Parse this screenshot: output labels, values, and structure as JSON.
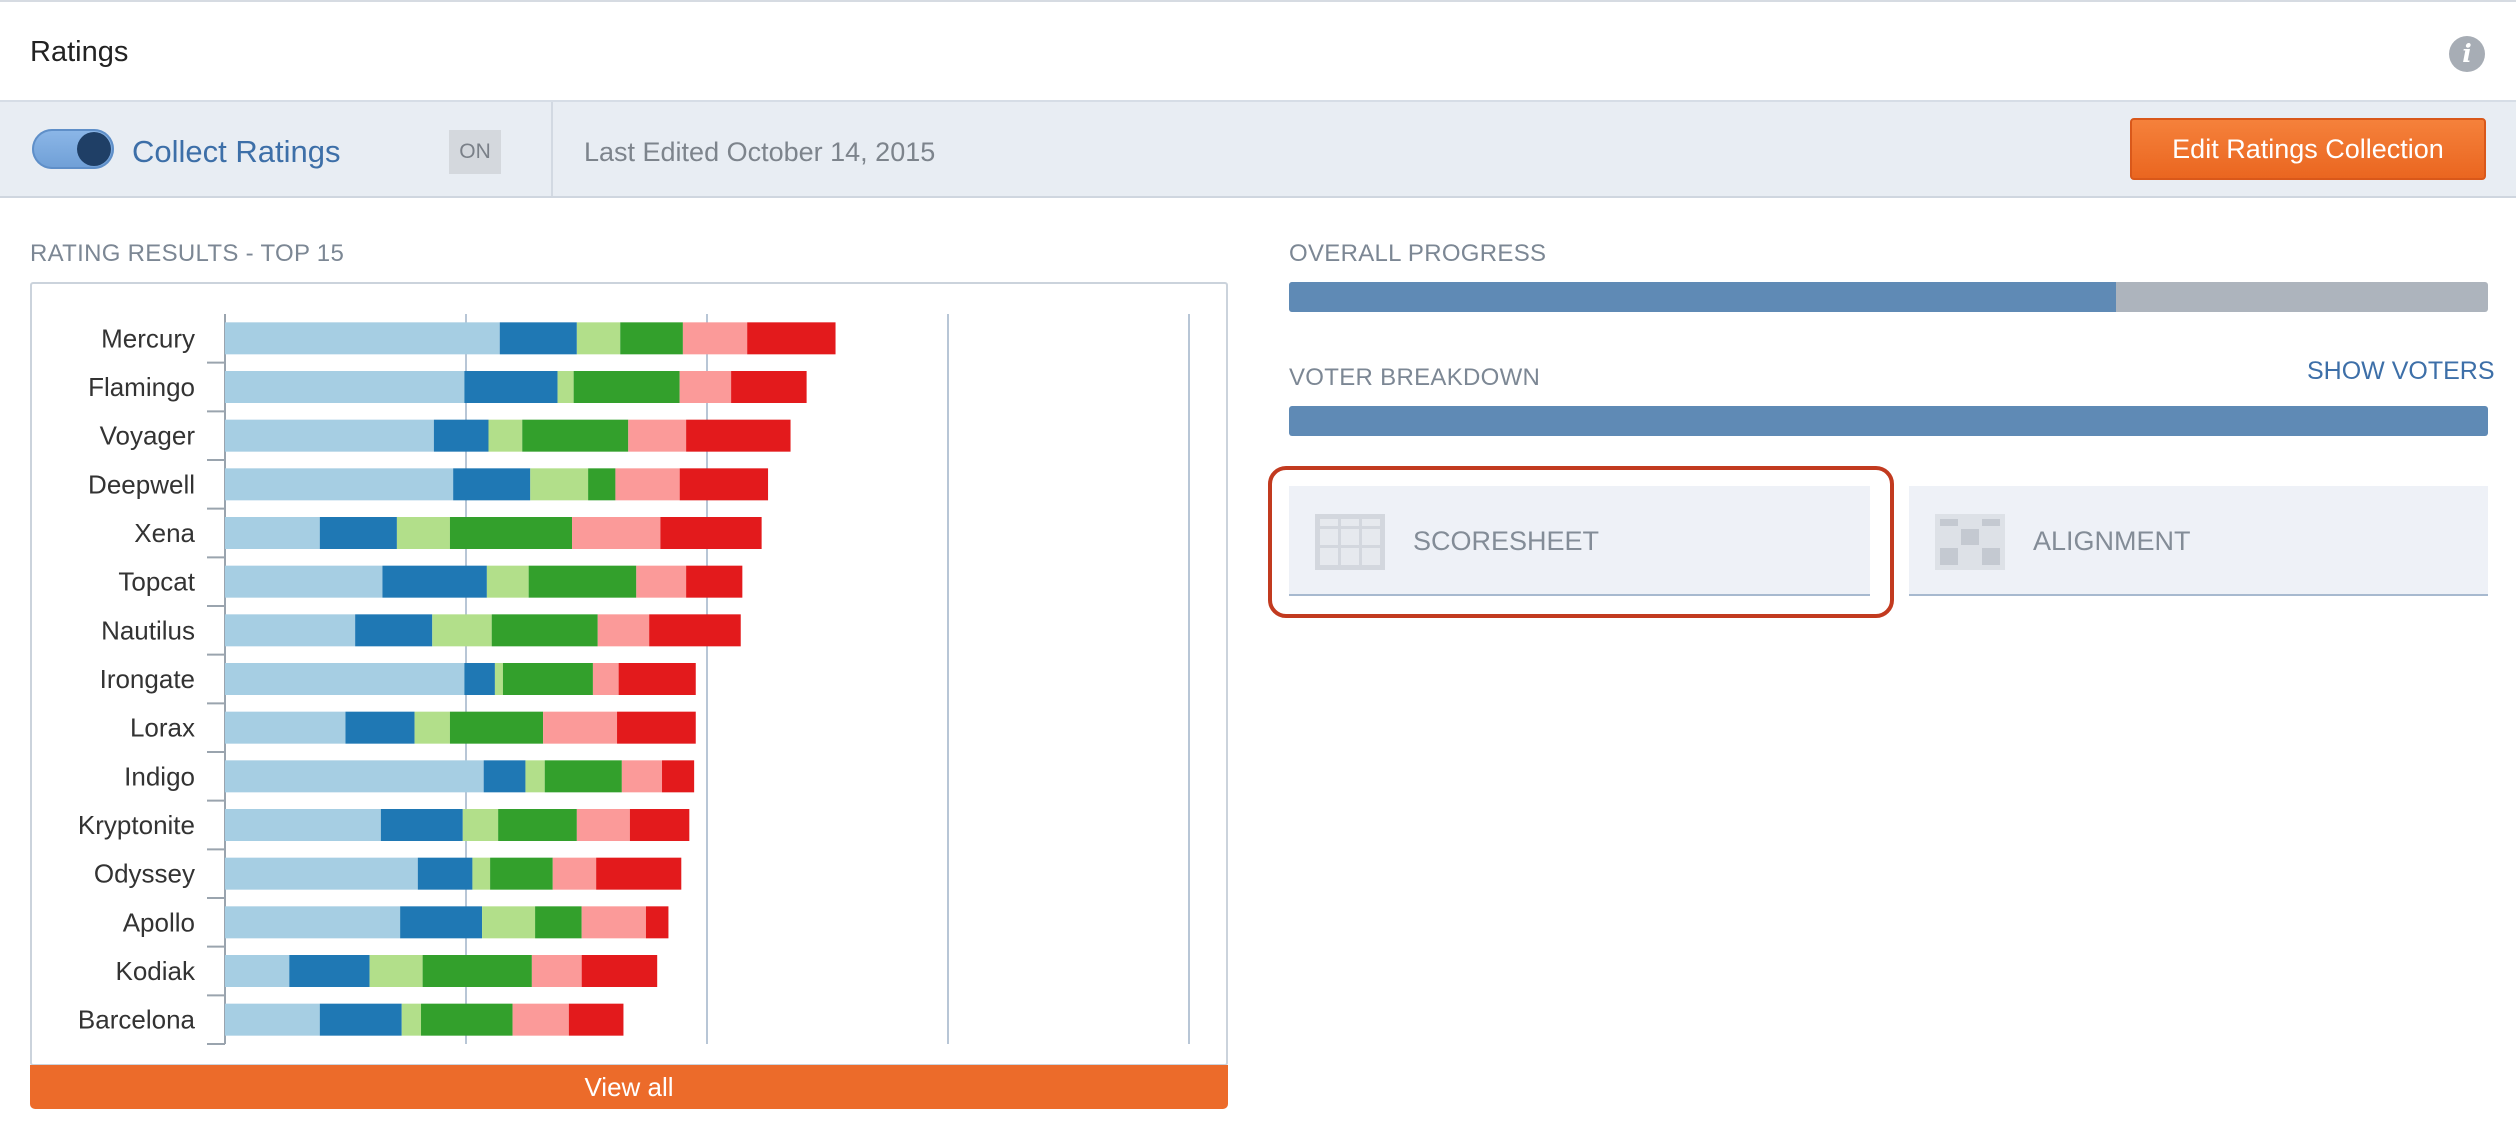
{
  "header": {
    "title": "Ratings"
  },
  "toolbar": {
    "toggle_label": "Collect Ratings",
    "toggle_state": "ON",
    "last_edited": "Last Edited October 14, 2015",
    "edit_button": "Edit Ratings Collection"
  },
  "results": {
    "label": "RATING RESULTS - TOP 15",
    "view_all": "View all"
  },
  "progress": {
    "overall_label": "OVERALL PROGRESS",
    "overall_fraction": 0.69,
    "voter_label": "VOTER BREAKDOWN",
    "voter_fraction": 1.0,
    "show_voters": "SHOW VOTERS"
  },
  "tiles": [
    {
      "label": "SCORESHEET",
      "icon": "scoresheet-grid-icon",
      "highlighted": true
    },
    {
      "label": "ALIGNMENT",
      "icon": "alignment-grid-icon",
      "highlighted": false
    }
  ],
  "colors": {
    "accent_orange": "#ec6b2a",
    "brand_blue": "#3d6fa8",
    "highlight_red": "#c23a1f",
    "segments": [
      "#a6cee3",
      "#1f78b4",
      "#b2df8a",
      "#33a02c",
      "#fb9a99",
      "#e31a1c"
    ]
  },
  "chart_data": {
    "type": "bar",
    "orientation": "horizontal",
    "stacked": true,
    "grid": true,
    "categories": [
      "Mercury",
      "Flamingo",
      "Voyager",
      "Deepwell",
      "Xena",
      "Topcat",
      "Nautilus",
      "Irongate",
      "Lorax",
      "Indigo",
      "Kryptonite",
      "Odyssey",
      "Apollo",
      "Kodiak",
      "Barcelona"
    ],
    "segments": [
      [
        17.1,
        4.8,
        2.7,
        3.9,
        4.0,
        5.5
      ],
      [
        14.9,
        5.8,
        1.0,
        6.6,
        3.2,
        4.7
      ],
      [
        13.0,
        3.4,
        2.1,
        6.6,
        3.6,
        6.5
      ],
      [
        14.2,
        4.8,
        3.6,
        1.7,
        4.0,
        5.5
      ],
      [
        5.9,
        4.8,
        3.3,
        7.6,
        5.5,
        6.3
      ],
      [
        9.8,
        6.5,
        2.6,
        6.7,
        3.1,
        3.5
      ],
      [
        8.1,
        4.8,
        3.7,
        6.6,
        3.2,
        5.7
      ],
      [
        14.9,
        1.9,
        0.5,
        5.6,
        1.6,
        4.8
      ],
      [
        7.5,
        4.3,
        2.2,
        5.8,
        4.6,
        4.9
      ],
      [
        16.1,
        2.6,
        1.2,
        4.8,
        2.5,
        2.0
      ],
      [
        9.7,
        5.1,
        2.2,
        4.9,
        3.3,
        3.7
      ],
      [
        12.0,
        3.4,
        1.1,
        3.9,
        2.7,
        5.3
      ],
      [
        10.9,
        5.1,
        3.3,
        2.9,
        4.0,
        1.4
      ],
      [
        4.0,
        5.0,
        3.3,
        6.8,
        3.1,
        4.7
      ],
      [
        5.9,
        5.1,
        1.2,
        5.7,
        3.5,
        3.4
      ]
    ],
    "xlim": [
      0,
      60
    ],
    "gridlines": [
      0,
      15,
      30,
      45,
      60
    ]
  }
}
